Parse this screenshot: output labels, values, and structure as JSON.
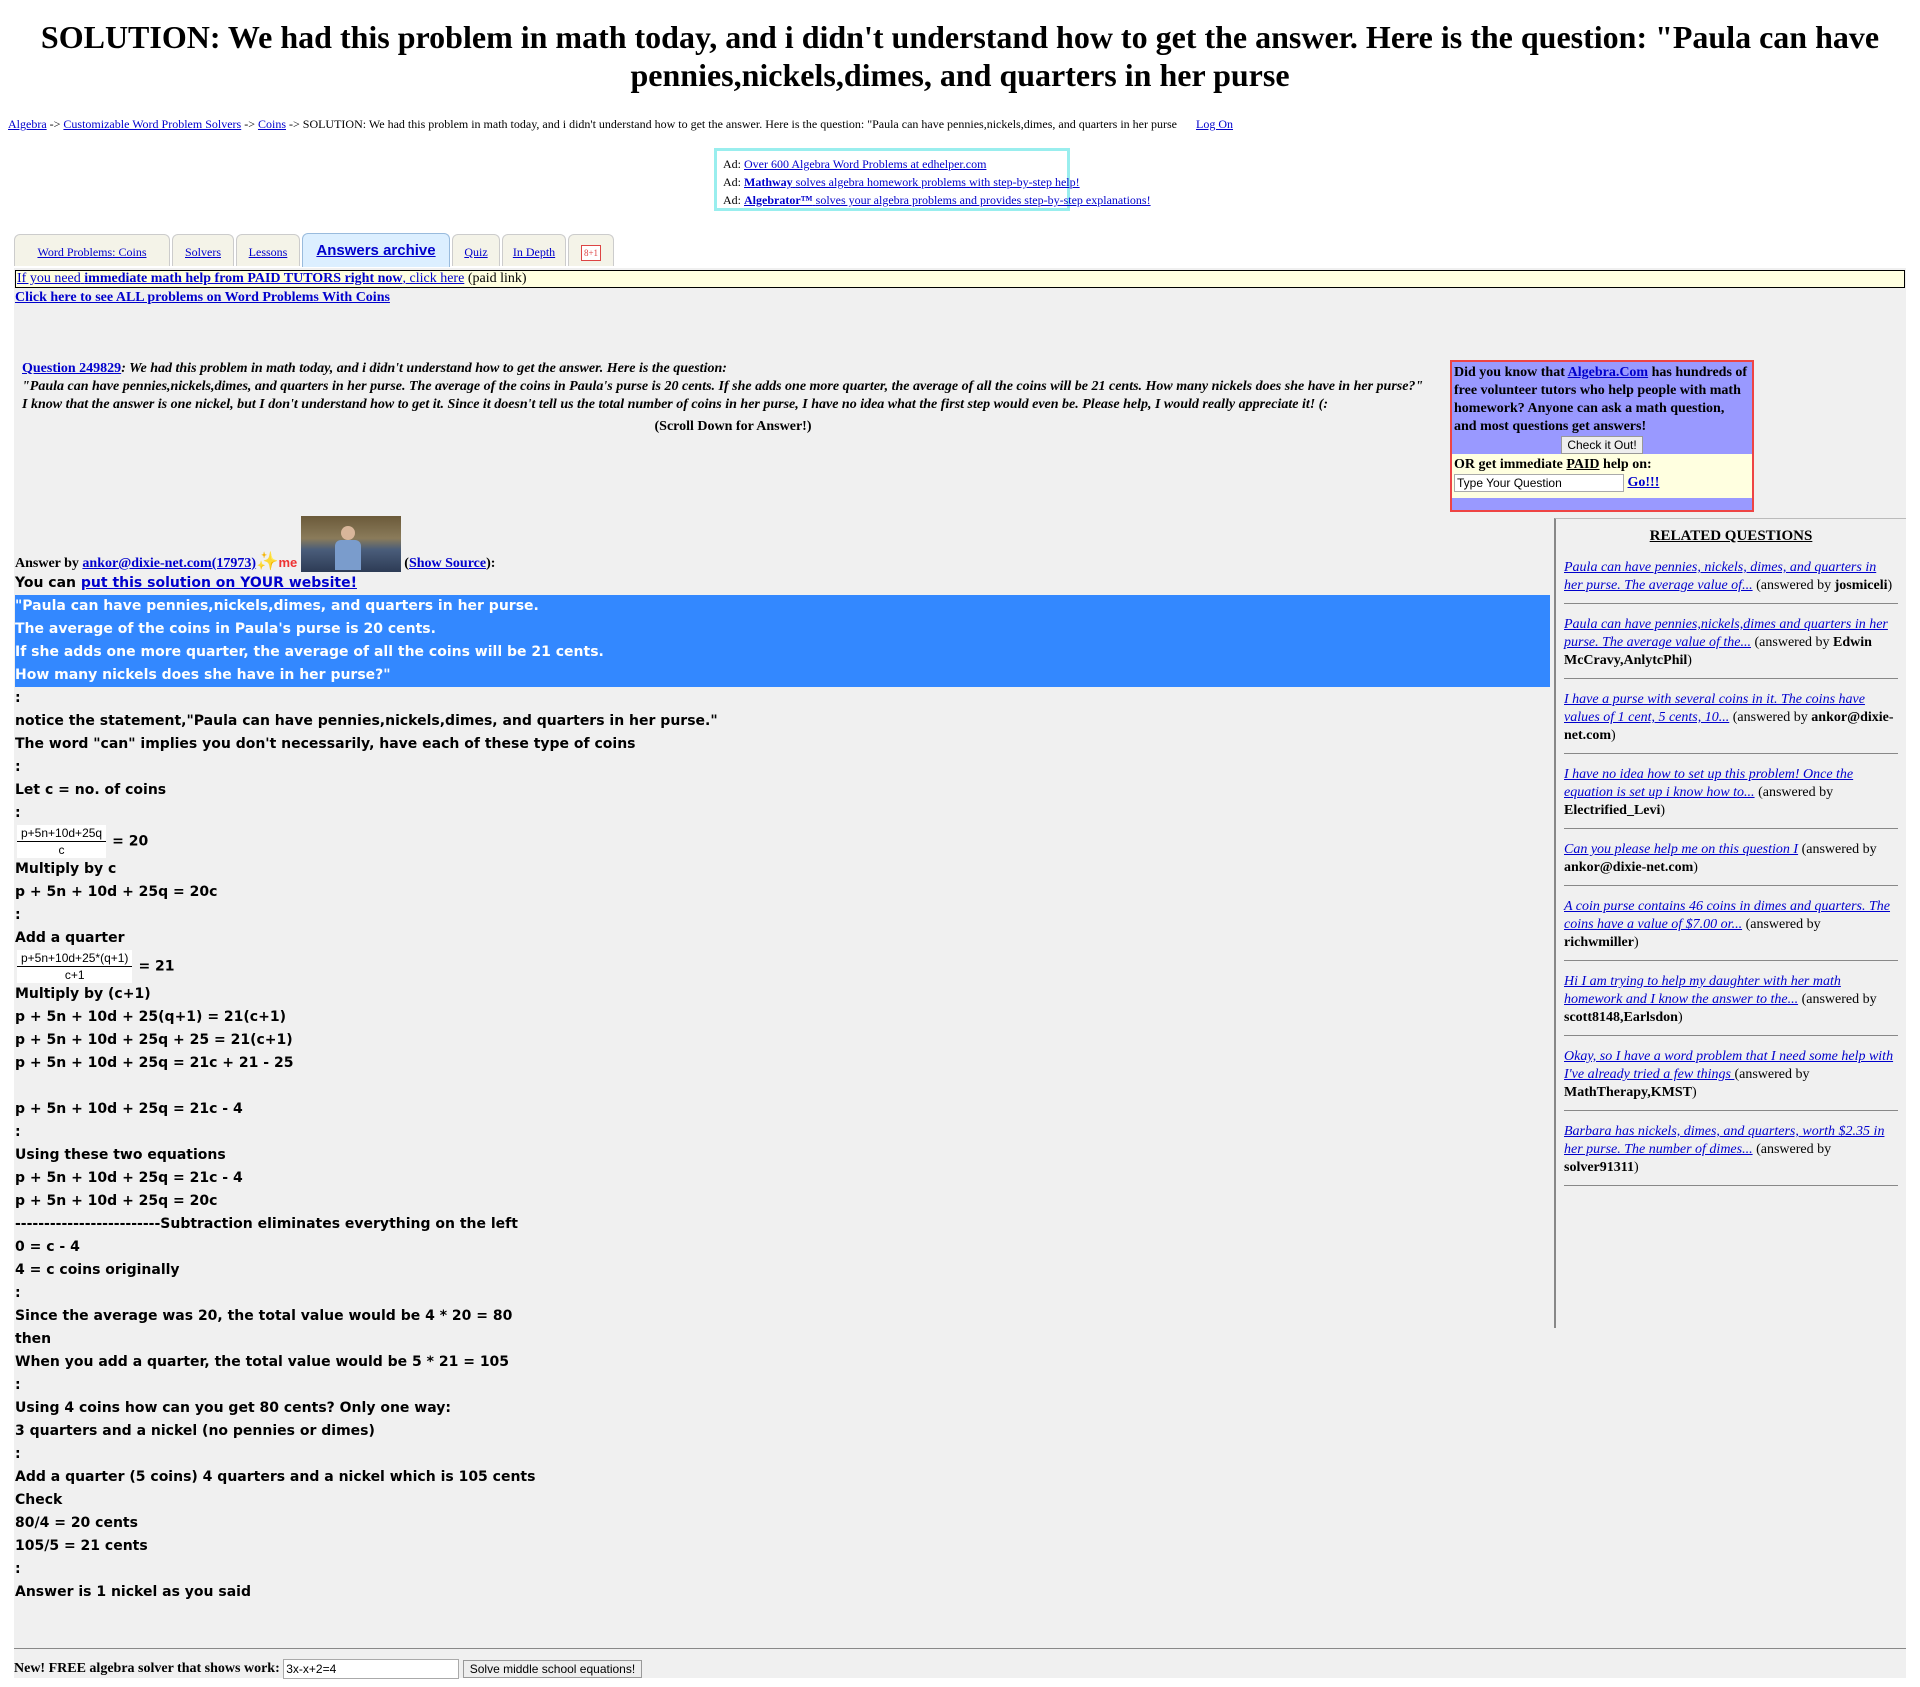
{
  "page_title": "SOLUTION: We had this problem in math today, and i didn't understand how to get the answer. Here is the question: \"Paula can have pennies,nickels,dimes, and quarters in her purse",
  "breadcrumb": {
    "items": [
      "Algebra",
      "Customizable Word Problem Solvers",
      "Coins"
    ],
    "sep": "->",
    "current": "SOLUTION: We had this problem in math today, and i didn't understand how to get the answer. Here is the question: \"Paula can have pennies,nickels,dimes, and quarters in her purse",
    "login": "Log On"
  },
  "ads": [
    {
      "prefix": "Ad:",
      "link": "Over 600 Algebra Word Problems at edhelper.com"
    },
    {
      "prefix": "Ad:",
      "bold": "Mathway",
      "link": "solves algebra homework problems with step-by-step help!"
    },
    {
      "prefix": "Ad:",
      "bold": "Algebrator™",
      "link": "solves your algebra problems and provides step-by-step explanations!"
    }
  ],
  "tabs": [
    "Word Problems: Coins",
    "Solvers",
    "Lessons",
    "Answers archive",
    "Quiz",
    "In Depth"
  ],
  "gplus": "8+1",
  "paid_link": {
    "pre": "If you need",
    "bold": "immediate math help from PAID TUTORS right now",
    "post": ", click here",
    "note": "(paid link)"
  },
  "all_problems": "Click here to see ALL problems on Word Problems With Coins",
  "question": {
    "link": "Question 249829",
    "line1": ": We had this problem in math today, and i didn't understand how to get the answer. Here is the question:",
    "line2": "\"Paula can have pennies,nickels,dimes, and quarters in her purse. The average of the coins in Paula's purse is 20 cents. If she adds one more quarter, the average of all the coins will be 21 cents. How many nickels does she have in her purse?\"",
    "line3": "I know that the answer is one nickel, but I don't understand how to get it. Since it doesn't tell us the total number of coins in her purse, I have no idea what the first step would even be. Please help, I would really appreciate it! (:",
    "scroll": "(Scroll Down for Answer!)"
  },
  "did_you_know": {
    "pre": "Did you know that",
    "link": "Algebra.Com",
    "post": "has hundreds of free volunteer tutors who help people with math homework? Anyone can ask a math question, and most questions get answers!",
    "button": "Check it Out!",
    "or_pre": "OR get immediate",
    "or_paid": "PAID",
    "or_post": "help on:",
    "input_value": "Type Your Question",
    "go": "Go!!!"
  },
  "related": {
    "title": "RELATED QUESTIONS",
    "items": [
      {
        "link": "Paula can have pennies, nickels, dimes, and quarters in her purse. The average value of...",
        "by": "josmiceli"
      },
      {
        "link": "Paula can have pennies,nickels,dimes and quarters in her purse. The average value of the...",
        "by": "Edwin McCravy,AnlytcPhil"
      },
      {
        "link": "I have a purse with several coins in it. The coins have values of 1 cent, 5 cents, 10...",
        "by": "ankor@dixie-net.com"
      },
      {
        "link": "I have no idea how to set up this problem! Once the equation is set up i know how to...",
        "by": "Electrified_Levi"
      },
      {
        "link": "Can you please help me on this question I",
        "by": "ankor@dixie-net.com"
      },
      {
        "link": "A coin purse contains 46 coins in dimes and quarters. The coins have a value of $7.00 or...",
        "by": "richwmiller"
      },
      {
        "link": "Hi I am trying to help my daughter with her math homework and I know the answer to the...",
        "by": "scott8148,Earlsdon"
      },
      {
        "link": "Okay, so I have a word problem that I need some help with I've already tried a few things ",
        "by": "MathTherapy,KMST"
      },
      {
        "link": "Barbara has nickels, dimes, and quarters, worth $2.35 in her purse. The number of dimes...",
        "by": "solver91311"
      }
    ],
    "answered_by": "(answered by"
  },
  "answer": {
    "by_label": "Answer by",
    "author": "ankor@dixie-net.com(17973)",
    "me": "me",
    "show_source": "Show Source",
    "put_pre": "You can",
    "put_link": "put this solution on YOUR website!",
    "highlighted": [
      "\"Paula can have pennies,nickels,dimes, and quarters in her purse.",
      "The average of the coins in Paula's purse is 20 cents.",
      "If she adds one more quarter, the average of all the coins will be 21 cents.",
      "How many nickels does she have in her purse?\""
    ],
    "block1": [
      ":",
      "notice the statement,\"Paula can have pennies,nickels,dimes, and quarters in her purse.\"",
      "The word \"can\" implies you don't necessarily, have each of these type of coins",
      ":",
      "Let c = no. of coins",
      ":"
    ],
    "frac1_num": "p+5n+10d+25q",
    "frac1_den": "c",
    "frac1_rhs": "= 20",
    "block2": [
      "Multiply by c",
      "p + 5n + 10d + 25q = 20c",
      ":",
      "Add a quarter"
    ],
    "frac2_num": "p+5n+10d+25*(q+1)",
    "frac2_den": "c+1",
    "frac2_rhs": "= 21",
    "block3": [
      "Multiply by (c+1)",
      "p + 5n + 10d + 25(q+1) = 21(c+1)",
      "p + 5n + 10d + 25q + 25 = 21(c+1)",
      "p + 5n + 10d + 25q = 21c + 21 - 25",
      "",
      "p + 5n + 10d + 25q = 21c - 4",
      ":",
      "Using these two equations",
      "p + 5n + 10d + 25q = 21c - 4",
      "p + 5n + 10d + 25q = 20c",
      "-------------------------Subtraction eliminates everything on the left",
      "0 = c - 4",
      "4 = c coins originally",
      ":",
      "Since the average was 20, the total value would be 4 * 20 = 80",
      "then",
      "When you add a quarter, the total value would be 5 * 21 = 105",
      ":",
      "Using 4 coins how can you get 80 cents? Only one way:",
      "3 quarters and a nickel (no pennies or dimes)",
      ":",
      "Add a quarter (5 coins) 4 quarters and a nickel which is 105 cents",
      "Check",
      "80/4 = 20 cents",
      "105/5 = 21 cents",
      ":",
      "Answer is 1 nickel as you said"
    ]
  },
  "footer": {
    "label": "New! FREE algebra solver that shows work:",
    "input_value": "3x-x+2=4",
    "button": "Solve middle school equations!"
  }
}
